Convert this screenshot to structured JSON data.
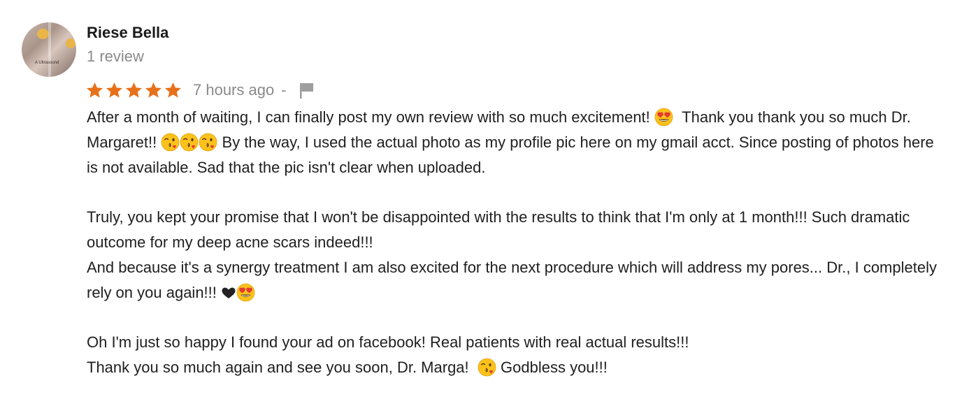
{
  "reviewer": {
    "name": "Riese Bella",
    "review_count": "1 review",
    "avatar_caption": "A Ultrasound"
  },
  "meta": {
    "rating": 5,
    "rating_max": 5,
    "time_ago": "7 hours ago",
    "separator": "-"
  },
  "colors": {
    "star": "#e7711b",
    "name": "#1a1a1a",
    "muted": "#8a8a8a",
    "text": "#1f1f1f",
    "flag": "#9e9e9e"
  },
  "review": {
    "p1_a": "After a month of waiting, I can finally post my own review with so much excitement!",
    "p1_b": "Thank you thank you so much Dr. Margaret!!",
    "p1_c": "By the way, I used the actual photo as my profile pic here on my gmail acct. Since posting of photos here is not available. Sad that the pic isn't clear when uploaded.",
    "p2_a": "Truly, you kept your promise that I won't be disappointed with the results to think that I'm only at 1 month!!! Such dramatic outcome for my deep acne scars indeed!!!",
    "p2_b": "And because it's a synergy treatment I am also excited for the next procedure which  will address my pores... Dr., I completely rely on you again!!!",
    "p3_a": "Oh I'm just so happy I found your ad on facebook! Real patients with real actual results!!!",
    "p3_b": "Thank you so much again and see you soon, Dr. Marga!",
    "p3_c": "Godbless you!!!"
  },
  "icons": {
    "star": "star-icon",
    "flag": "flag-icon",
    "heart_eyes": "heart-eyes-emoji",
    "kissing": "kissing-face-emoji",
    "heart": "heart-icon"
  }
}
